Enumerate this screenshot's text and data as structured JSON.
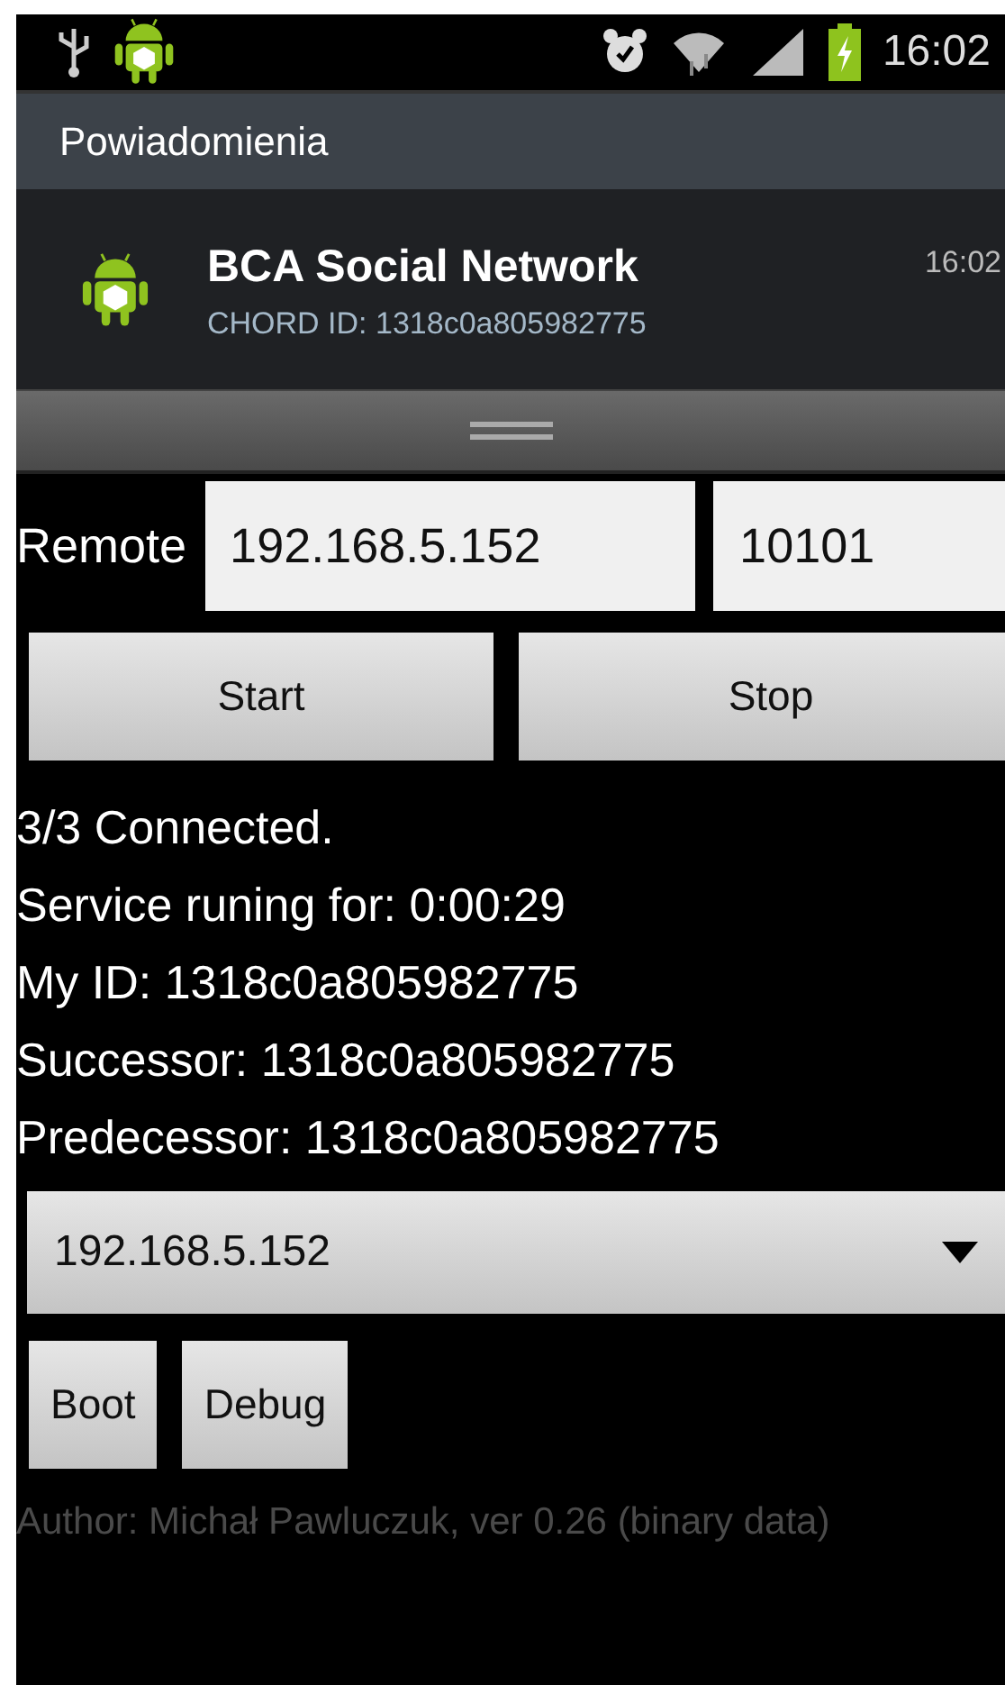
{
  "status_bar": {
    "time": "16:02"
  },
  "notifications": {
    "title": "Powiadomienia",
    "items": [
      {
        "title": "BCA Social Network",
        "text": "CHORD ID: 1318c0a805982775",
        "time": "16:02"
      }
    ]
  },
  "remote": {
    "label": "Remote",
    "host": "192.168.5.152",
    "port": "10101"
  },
  "service_buttons": [
    "Start",
    "Stop"
  ],
  "status_lines": [
    "3/3 Connected.",
    "Service runing for: 0:00:29",
    "My ID: 1318c0a805982775",
    "Successor: 1318c0a805982775",
    "Predecessor: 1318c0a805982775"
  ],
  "node_select": {
    "value": "192.168.5.152"
  },
  "tool_buttons": [
    "Boot",
    "Debug"
  ],
  "footer": "Author: Michał Pawluczuk, ver 0.26 (binary data)"
}
